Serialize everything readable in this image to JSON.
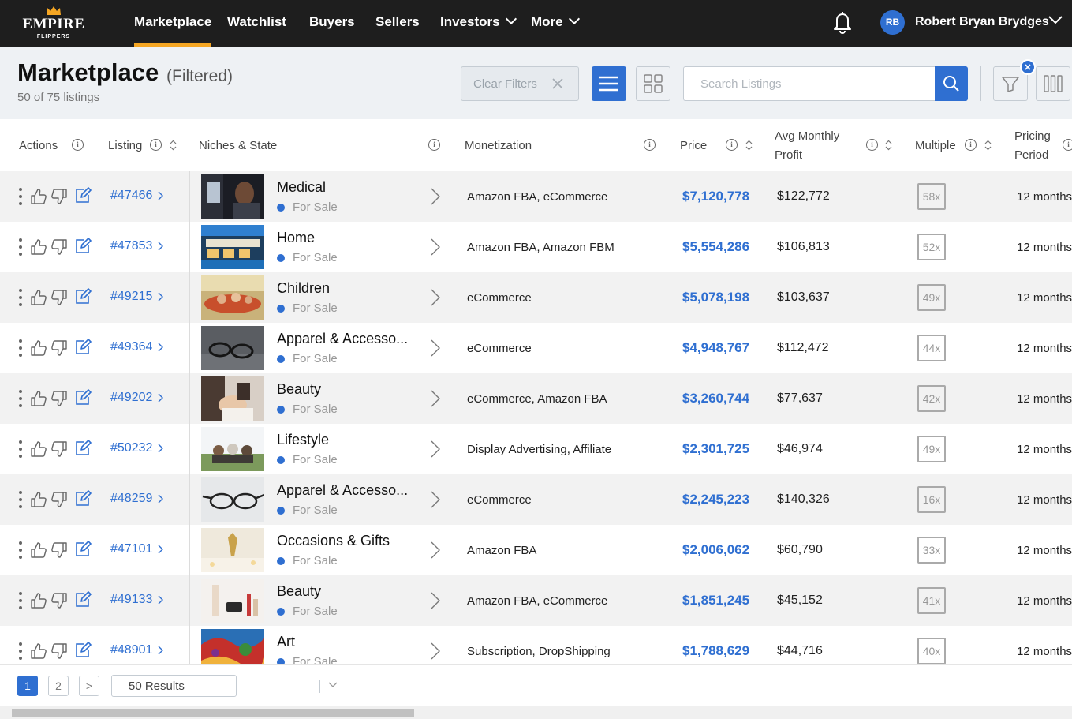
{
  "brand": {
    "name": "EMPIRE",
    "sub": "FLIPPERS"
  },
  "nav": {
    "items": [
      "Marketplace",
      "Watchlist",
      "Buyers",
      "Sellers",
      "Investors",
      "More"
    ],
    "active": "Marketplace",
    "accent": "#f5a623"
  },
  "user": {
    "initials": "RB",
    "name": "Robert Bryan Brydges"
  },
  "header": {
    "title": "Marketplace",
    "filter_state": "(Filtered)",
    "count": "50 of 75 listings",
    "clear_filters": "Clear Filters",
    "search_placeholder": "Search Listings"
  },
  "columns": {
    "actions": "Actions",
    "listing": "Listing",
    "niches": "Niches & State",
    "monetization": "Monetization",
    "price": "Price",
    "profit_line1": "Avg Monthly",
    "profit_line2": "Profit",
    "multiple": "Multiple",
    "period_line1": "Pricing",
    "period_line2": "Period"
  },
  "rows": [
    {
      "id": "#47466",
      "niche": "Medical",
      "state": "For Sale",
      "monetization": "Amazon FBA, eCommerce",
      "price": "$7,120,778",
      "profit": "$122,772",
      "multiple": "58x",
      "period": "12 months"
    },
    {
      "id": "#47853",
      "niche": "Home",
      "state": "For Sale",
      "monetization": "Amazon FBA, Amazon FBM",
      "price": "$5,554,286",
      "profit": "$106,813",
      "multiple": "52x",
      "period": "12 months"
    },
    {
      "id": "#49215",
      "niche": "Children",
      "state": "For Sale",
      "monetization": "eCommerce",
      "price": "$5,078,198",
      "profit": "$103,637",
      "multiple": "49x",
      "period": "12 months"
    },
    {
      "id": "#49364",
      "niche": "Apparel & Accesso...",
      "state": "For Sale",
      "monetization": "eCommerce",
      "price": "$4,948,767",
      "profit": "$112,472",
      "multiple": "44x",
      "period": "12 months"
    },
    {
      "id": "#49202",
      "niche": "Beauty",
      "state": "For Sale",
      "monetization": "eCommerce, Amazon FBA",
      "price": "$3,260,744",
      "profit": "$77,637",
      "multiple": "42x",
      "period": "12 months"
    },
    {
      "id": "#50232",
      "niche": "Lifestyle",
      "state": "For Sale",
      "monetization": "Display Advertising, Affiliate",
      "price": "$2,301,725",
      "profit": "$46,974",
      "multiple": "49x",
      "period": "12 months"
    },
    {
      "id": "#48259",
      "niche": "Apparel & Accesso...",
      "state": "For Sale",
      "monetization": "eCommerce",
      "price": "$2,245,223",
      "profit": "$140,326",
      "multiple": "16x",
      "period": "12 months"
    },
    {
      "id": "#47101",
      "niche": "Occasions & Gifts",
      "state": "For Sale",
      "monetization": "Amazon FBA",
      "price": "$2,006,062",
      "profit": "$60,790",
      "multiple": "33x",
      "period": "12 months"
    },
    {
      "id": "#49133",
      "niche": "Beauty",
      "state": "For Sale",
      "monetization": "Amazon FBA, eCommerce",
      "price": "$1,851,245",
      "profit": "$45,152",
      "multiple": "41x",
      "period": "12 months"
    },
    {
      "id": "#48901",
      "niche": "Art",
      "state": "For Sale",
      "monetization": "Subscription, DropShipping",
      "price": "$1,788,629",
      "profit": "$44,716",
      "multiple": "40x",
      "period": "12 months"
    }
  ],
  "pagination": {
    "pages": [
      "1",
      "2"
    ],
    "current": "1",
    "next": ">",
    "per_page": "50 Results"
  },
  "colors": {
    "accent_blue": "#2f6fd1",
    "nav_bg": "#1e1e1e",
    "header_bg": "#eef1f4"
  }
}
